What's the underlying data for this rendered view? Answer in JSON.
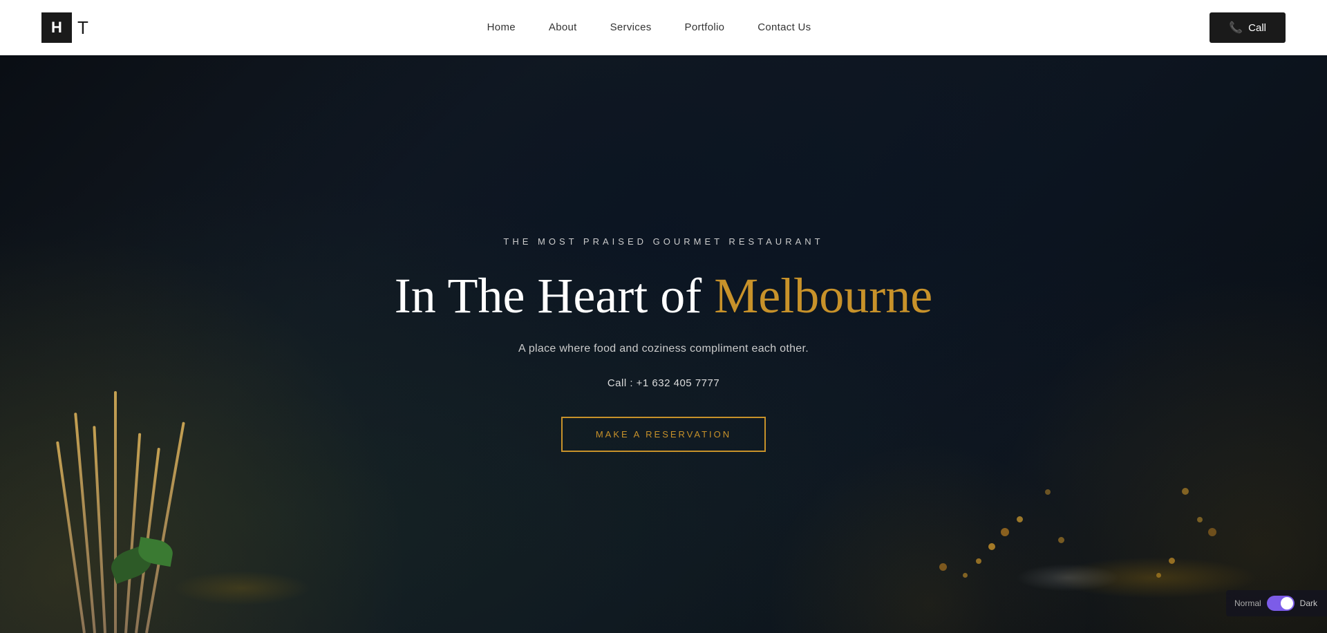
{
  "logo": {
    "h_letter": "H",
    "t_letter": "T"
  },
  "navbar": {
    "links": [
      {
        "label": "Home",
        "id": "home"
      },
      {
        "label": "About",
        "id": "about"
      },
      {
        "label": "Services",
        "id": "services"
      },
      {
        "label": "Portfolio",
        "id": "portfolio"
      },
      {
        "label": "Contact Us",
        "id": "contact"
      }
    ],
    "call_button": "Call",
    "call_icon": "📞"
  },
  "hero": {
    "subtitle": "THE MOST PRAISED GOURMET RESTAURANT",
    "title_part1": "In The Heart of ",
    "title_part2": "Melbourne",
    "description": "A place where food and coziness compliment each other.",
    "phone_label": "Call : +1 632 405 7777",
    "cta_button": "MAKE A RESERVATION"
  },
  "theme_toggle": {
    "label_normal": "Normal",
    "label_dark": "Dark"
  }
}
